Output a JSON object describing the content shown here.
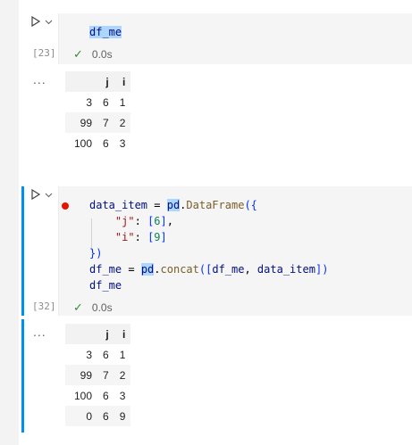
{
  "cells": [
    {
      "exec_count": "[23]",
      "code": "df_me",
      "status_time": "0.0s",
      "table": {
        "columns": [
          "",
          "j",
          "i"
        ],
        "rows": [
          [
            "3",
            "6",
            "1"
          ],
          [
            "99",
            "7",
            "2"
          ],
          [
            "100",
            "6",
            "3"
          ]
        ]
      }
    },
    {
      "exec_count": "[32]",
      "code_lines": [
        "data_item = pd.DataFrame({",
        "    \"j\": [6],",
        "    \"i\": [9]",
        "})",
        "df_me = pd.concat([df_me, data_item])",
        "df_me"
      ],
      "status_time": "0.0s",
      "table": {
        "columns": [
          "",
          "j",
          "i"
        ],
        "rows": [
          [
            "3",
            "6",
            "1"
          ],
          [
            "99",
            "7",
            "2"
          ],
          [
            "100",
            "6",
            "3"
          ],
          [
            "0",
            "6",
            "9"
          ]
        ]
      }
    }
  ],
  "ui": {
    "output_ellipsis": "...",
    "check_symbol": "✓",
    "accent_color": "#0090f1",
    "breakpoint_color": "#e51400"
  }
}
